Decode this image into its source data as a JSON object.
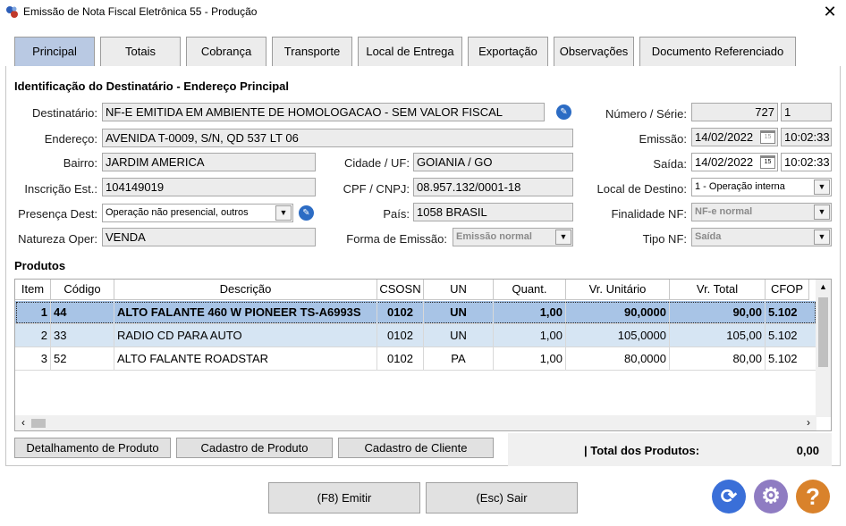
{
  "window": {
    "title": "Emissão de Nota Fiscal Eletrônica 55 - Produção",
    "close": "✕"
  },
  "tabs": [
    "Principal",
    "Totais",
    "Cobrança",
    "Transporte",
    "Local de Entrega",
    "Exportação",
    "Observações",
    "Documento Referenciado"
  ],
  "section_title": "Identificação do Destinatário - Endereço Principal",
  "fields": {
    "destinatario": {
      "label": "Destinatário:",
      "value": "NF-E EMITIDA EM AMBIENTE DE HOMOLOGACAO - SEM VALOR FISCAL"
    },
    "endereco": {
      "label": "Endereço:",
      "value": "AVENIDA T-0009, S/N, QD 537 LT 06"
    },
    "bairro": {
      "label": "Bairro:",
      "value": "JARDIM AMERICA"
    },
    "cidade_uf": {
      "label": "Cidade / UF:",
      "value": "GOIANIA / GO"
    },
    "inscricao": {
      "label": "Inscrição Est.:",
      "value": "104149019"
    },
    "cpf_cnpj": {
      "label": "CPF / CNPJ:",
      "value": "08.957.132/0001-18"
    },
    "presenca": {
      "label": "Presença Dest:",
      "value": "Operação não presencial, outros"
    },
    "pais": {
      "label": "País:",
      "value": "1058 BRASIL"
    },
    "natureza": {
      "label": "Natureza Oper:",
      "value": "VENDA"
    },
    "forma_emissao": {
      "label": "Forma de Emissão:",
      "value": "Emissão normal"
    },
    "numero_serie": {
      "label": "Número / Série:",
      "numero": "727",
      "serie": "1"
    },
    "emissao": {
      "label": "Emissão:",
      "date": "14/02/2022",
      "time": "10:02:33"
    },
    "saida": {
      "label": "Saída:",
      "date": "14/02/2022",
      "time": "10:02:33"
    },
    "local_destino": {
      "label": "Local de Destino:",
      "value": "1 - Operação interna"
    },
    "finalidade": {
      "label": "Finalidade NF:",
      "value": "NF-e normal"
    },
    "tipo_nf": {
      "label": "Tipo NF:",
      "value": "Saída"
    },
    "calendar_day": "15"
  },
  "produtos": {
    "title": "Produtos",
    "columns": [
      "Item",
      "Código",
      "Descrição",
      "CSOSN",
      "UN",
      "Quant.",
      "Vr. Unitário",
      "Vr. Total",
      "CFOP"
    ],
    "rows": [
      [
        "1",
        "44",
        "ALTO FALANTE 460 W PIONEER TS-A6993S",
        "0102",
        "UN",
        "1,00",
        "90,0000",
        "90,00",
        "5.102"
      ],
      [
        "2",
        "33",
        "RADIO CD PARA AUTO",
        "0102",
        "UN",
        "1,00",
        "105,0000",
        "105,00",
        "5.102"
      ],
      [
        "3",
        "52",
        "ALTO FALANTE ROADSTAR",
        "0102",
        "PA",
        "1,00",
        "80,0000",
        "80,00",
        "5.102"
      ]
    ]
  },
  "buttons": {
    "detalhamento": "Detalhamento de Produto",
    "cadastro_produto": "Cadastro de Produto",
    "cadastro_cliente": "Cadastro de Cliente",
    "emitir": "(F8) Emitir",
    "sair": "(Esc) Sair"
  },
  "total": {
    "label": "| Total dos Produtos:",
    "value": "0,00"
  },
  "colors": {
    "active_tab": "#b9c9e3",
    "selected_row": "#a8c4e6",
    "alt_row": "#d6e5f3",
    "refresh": "#3a6fd8",
    "settings": "#8f7cc2",
    "help": "#d9822b"
  }
}
